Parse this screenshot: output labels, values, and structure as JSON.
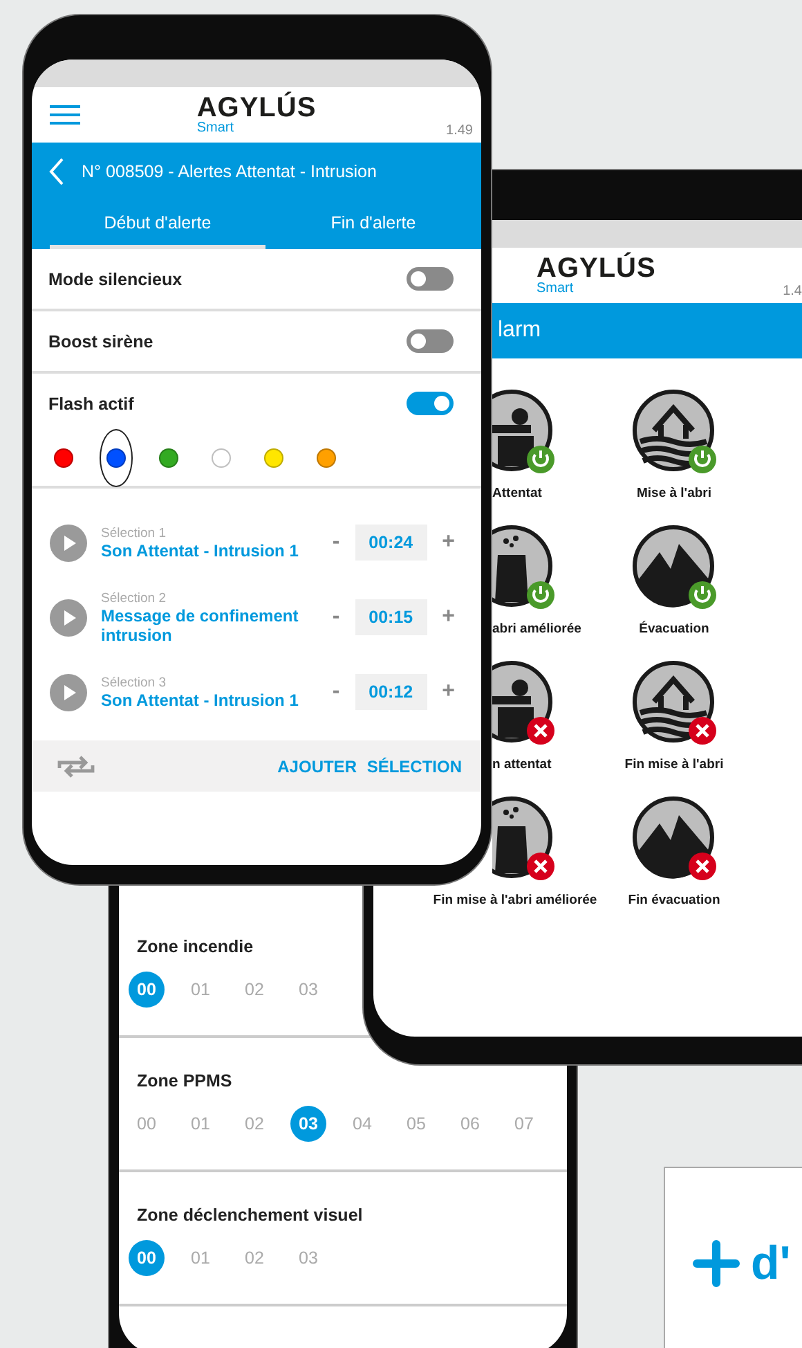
{
  "phone_front": {
    "header": {
      "logo": "AGYLÚS",
      "logo_sub": "Smart",
      "version": "1.49"
    },
    "title": "N° 008509 - Alertes Attentat - Intrusion",
    "tabs": [
      {
        "label": "Début d'alerte",
        "selected": true
      },
      {
        "label": "Fin d'alerte",
        "selected": false
      }
    ],
    "toggles": [
      {
        "label": "Mode silencieux",
        "on": false
      },
      {
        "label": "Boost sirène",
        "on": false
      },
      {
        "label": "Flash actif",
        "on": true
      }
    ],
    "flash_colors": [
      {
        "color": "#ff0000",
        "selected": false
      },
      {
        "color": "#0050ff",
        "selected": true
      },
      {
        "color": "#33aa22",
        "selected": false
      },
      {
        "color": "#ffffff",
        "selected": false
      },
      {
        "color": "#ffe600",
        "selected": false
      },
      {
        "color": "#ffa000",
        "selected": false
      }
    ],
    "selections": [
      {
        "caption": "Sélection 1",
        "name": "Son Attentat - Intrusion 1",
        "minus": "-",
        "duration": "00:24",
        "plus": "+"
      },
      {
        "caption": "Sélection 2",
        "name": "Message de confinement intrusion",
        "minus": "-",
        "duration": "00:15",
        "plus": "+"
      },
      {
        "caption": "Sélection 3",
        "name": "Son Attentat - Intrusion 1",
        "minus": "-",
        "duration": "00:12",
        "plus": "+"
      }
    ],
    "footer": {
      "action": "AJOUTER SÉLECTION"
    }
  },
  "phone_alarm": {
    "header": {
      "logo": "AGYLÚS",
      "logo_sub": "Smart",
      "version": "1.4"
    },
    "title": "larm",
    "alarms": [
      {
        "kind": "person",
        "label": "Attentat",
        "active": true
      },
      {
        "kind": "house",
        "label": "Mise à l'abri",
        "active": true
      },
      {
        "kind": "tower",
        "label": "abri améliorée",
        "active": true
      },
      {
        "kind": "mountain",
        "label": "Évacuation",
        "active": true
      },
      {
        "kind": "person",
        "label": "n attentat",
        "active": false
      },
      {
        "kind": "house",
        "label": "Fin mise à l'abri",
        "active": false
      },
      {
        "kind": "tower",
        "label": "Fin mise à l'abri améliorée",
        "active": false
      },
      {
        "kind": "mountain",
        "label": "Fin évacuation",
        "active": false
      }
    ]
  },
  "phone_zones": {
    "zones": [
      {
        "title": "Zone incendie",
        "options": [
          {
            "label": "00",
            "selected": true
          },
          {
            "label": "01",
            "selected": false
          },
          {
            "label": "02",
            "selected": false
          },
          {
            "label": "03",
            "selected": false
          }
        ]
      },
      {
        "title": "Zone PPMS",
        "options": [
          {
            "label": "00",
            "selected": false
          },
          {
            "label": "01",
            "selected": false
          },
          {
            "label": "02",
            "selected": false
          },
          {
            "label": "03",
            "selected": true
          },
          {
            "label": "04",
            "selected": false
          },
          {
            "label": "05",
            "selected": false
          },
          {
            "label": "06",
            "selected": false
          },
          {
            "label": "07",
            "selected": false
          }
        ]
      },
      {
        "title": "Zone déclenchement visuel",
        "options": [
          {
            "label": "00",
            "selected": true
          },
          {
            "label": "01",
            "selected": false
          },
          {
            "label": "02",
            "selected": false
          },
          {
            "label": "03",
            "selected": false
          }
        ]
      }
    ]
  },
  "card": {
    "text": "d'"
  }
}
